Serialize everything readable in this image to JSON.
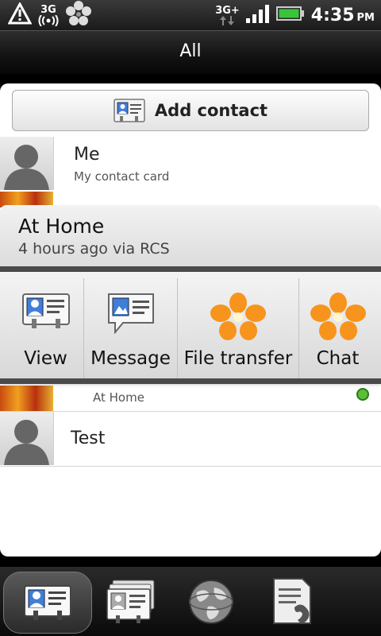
{
  "status_bar": {
    "network_type_left": "3G",
    "network_type_right": "3G+",
    "time": "4:35",
    "ampm": "PM",
    "battery_color": "#3ac43a"
  },
  "header": {
    "title": "All"
  },
  "contacts": {
    "add_contact_label": "Add contact",
    "items": [
      {
        "name": "Me",
        "subtitle": "My contact card"
      },
      {
        "name": "",
        "subtitle": "At Home"
      },
      {
        "name": "Test",
        "subtitle": ""
      }
    ]
  },
  "quick_contact": {
    "name": "At Home",
    "status": "4 hours ago via RCS",
    "actions": [
      {
        "label": "View"
      },
      {
        "label": "Message"
      },
      {
        "label": "File transfer"
      },
      {
        "label": "Chat"
      }
    ],
    "accent_color": "#f7941d"
  },
  "tabs": [
    {
      "icon": "people-icon",
      "active": true
    },
    {
      "icon": "groups-icon",
      "active": false
    },
    {
      "icon": "online-directory-icon",
      "active": false
    },
    {
      "icon": "call-history-icon",
      "active": false
    }
  ]
}
